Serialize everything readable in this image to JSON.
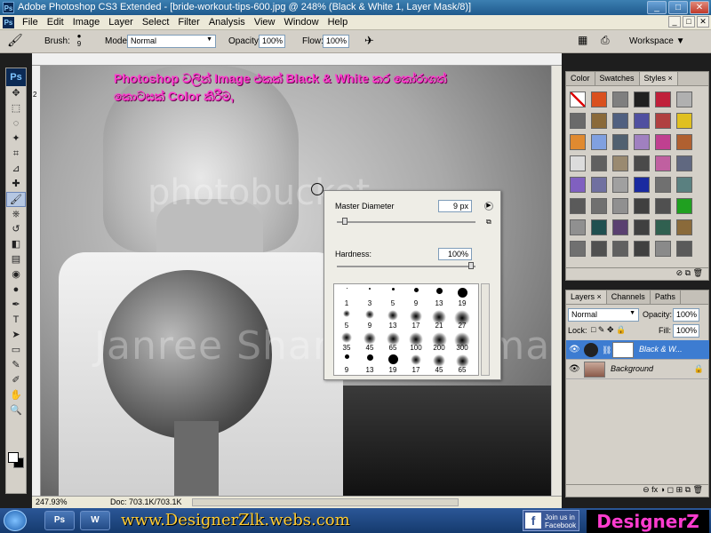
{
  "window": {
    "app_icon": "Ps",
    "title": "Adobe Photoshop CS3 Extended - [bride-workout-tips-600.jpg @ 248% (Black & White 1, Layer Mask/8)]",
    "controls": [
      "_",
      "□",
      "✕"
    ]
  },
  "menu": {
    "items": [
      "File",
      "Edit",
      "Image",
      "Layer",
      "Select",
      "Filter",
      "Analysis",
      "View",
      "Window",
      "Help"
    ]
  },
  "options_bar": {
    "brush_label": "Brush:",
    "brush_size": "9",
    "mode_label": "Mode:",
    "mode_value": "Normal",
    "opacity_label": "Opacity:",
    "opacity_value": "100%",
    "flow_label": "Flow:",
    "flow_value": "100%",
    "workspace_label": "Workspace ▼"
  },
  "toolbox": {
    "logo": "Ps",
    "tools": [
      "move-icon",
      "marquee-icon",
      "lasso-icon",
      "magic-wand-icon",
      "crop-icon",
      "slice-icon",
      "healing-icon",
      "brush-icon",
      "stamp-icon",
      "history-brush-icon",
      "eraser-icon",
      "gradient-icon",
      "blur-icon",
      "dodge-icon",
      "pen-icon",
      "type-icon",
      "path-select-icon",
      "shape-icon",
      "notes-icon",
      "eyedropper-icon",
      "hand-icon",
      "zoom-icon"
    ],
    "glyphs": [
      "✥",
      "⬚",
      "◌",
      "✦",
      "⌗",
      "⊿",
      "✚",
      "🖌",
      "⎈",
      "↺",
      "◧",
      "▤",
      "◉",
      "●",
      "✒",
      "T",
      "➤",
      "▭",
      "✎",
      "✐",
      "✋",
      "🔍"
    ],
    "active_index": 7
  },
  "canvas": {
    "caption_line1": "Photoshop වලින් Image එකක් Black & White කර කෝරාගත්",
    "caption_line2": "කොටසක් Color කිරීම,",
    "watermark1": "photobucket",
    "watermark2": "Janree Share Watermark",
    "ruler_marks": [
      "1",
      "2"
    ]
  },
  "status_bar": {
    "zoom": "247.93%",
    "doc": "Doc: 703.1K/703.1K"
  },
  "brush_popup": {
    "master_diameter_label": "Master Diameter",
    "master_diameter_value": "9 px",
    "hardness_label": "Hardness:",
    "hardness_value": "100%",
    "presets": [
      {
        "size": "1",
        "kind": "hard",
        "d": 1
      },
      {
        "size": "3",
        "kind": "hard",
        "d": 2
      },
      {
        "size": "5",
        "kind": "hard",
        "d": 3
      },
      {
        "size": "9",
        "kind": "hard",
        "d": 5
      },
      {
        "size": "13",
        "kind": "hard",
        "d": 7
      },
      {
        "size": "19",
        "kind": "hard",
        "d": 11
      },
      {
        "size": "5",
        "kind": "soft",
        "d": 4
      },
      {
        "size": "9",
        "kind": "soft",
        "d": 6
      },
      {
        "size": "13",
        "kind": "soft",
        "d": 8
      },
      {
        "size": "17",
        "kind": "soft",
        "d": 10
      },
      {
        "size": "21",
        "kind": "soft",
        "d": 12
      },
      {
        "size": "27",
        "kind": "soft",
        "d": 14
      },
      {
        "size": "35",
        "kind": "soft",
        "d": 8
      },
      {
        "size": "45",
        "kind": "soft",
        "d": 10
      },
      {
        "size": "65",
        "kind": "soft",
        "d": 11
      },
      {
        "size": "100",
        "kind": "soft",
        "d": 12
      },
      {
        "size": "200",
        "kind": "soft",
        "d": 13
      },
      {
        "size": "300",
        "kind": "soft",
        "d": 14
      },
      {
        "size": "9",
        "kind": "hard",
        "d": 5
      },
      {
        "size": "13",
        "kind": "hard",
        "d": 7
      },
      {
        "size": "19",
        "kind": "hard",
        "d": 11
      },
      {
        "size": "17",
        "kind": "soft",
        "d": 8
      },
      {
        "size": "45",
        "kind": "soft",
        "d": 10
      },
      {
        "size": "65",
        "kind": "soft",
        "d": 11
      }
    ]
  },
  "styles_panel": {
    "tabs": [
      "Color",
      "Swatches",
      "Styles ×"
    ],
    "active_tab": 2,
    "swatch_colors": [
      "#ffffff",
      "#d9501e",
      "#7f7f7f",
      "#202020",
      "#c0203a",
      "#b0b0b0",
      "#6a6a6a",
      "#8a6a3a",
      "#506080",
      "#5050a0",
      "#b04040",
      "#e0c020",
      "#e08a30",
      "#80a0e0",
      "#506070",
      "#a080c0",
      "#c04090",
      "#b06030",
      "#dcdcdc",
      "#606060",
      "#9a8a70",
      "#4a4a4a",
      "#c060a0",
      "#606880",
      "#8060c0",
      "#7070a0",
      "#a0a0a0",
      "#1a2aa0",
      "#707070",
      "#5a8080",
      "#5a5a5a",
      "#707070",
      "#909090",
      "#404040",
      "#505050",
      "#20a020",
      "#909090",
      "#205050",
      "#5a4070",
      "#404040",
      "#306050",
      "#8a6a3a",
      "#707070",
      "#505050",
      "#606060",
      "#404040",
      "#8a8a8a",
      "#5a5a5a"
    ],
    "footer": "⊘ ⧉ 🗑"
  },
  "layers_panel": {
    "tabs": [
      "Layers ×",
      "Channels",
      "Paths"
    ],
    "active_tab": 0,
    "blend_mode": "Normal",
    "opacity_label": "Opacity:",
    "opacity_value": "100%",
    "lock_label": "Lock:",
    "fill_label": "Fill:",
    "fill_value": "100%",
    "layers": [
      {
        "name": "Black & W...",
        "selected": true
      },
      {
        "name": "Background",
        "selected": false
      }
    ],
    "footer": "⊖ fx ◑ ◻ ⊞ ⧉ 🗑"
  },
  "taskbar": {
    "buttons": [
      "Ps",
      "W"
    ],
    "site": "www.DesignerZlk.webs.com",
    "fb_line1": "Join us in",
    "fb_line2": "Facebook",
    "logo": "DesignerZ"
  }
}
